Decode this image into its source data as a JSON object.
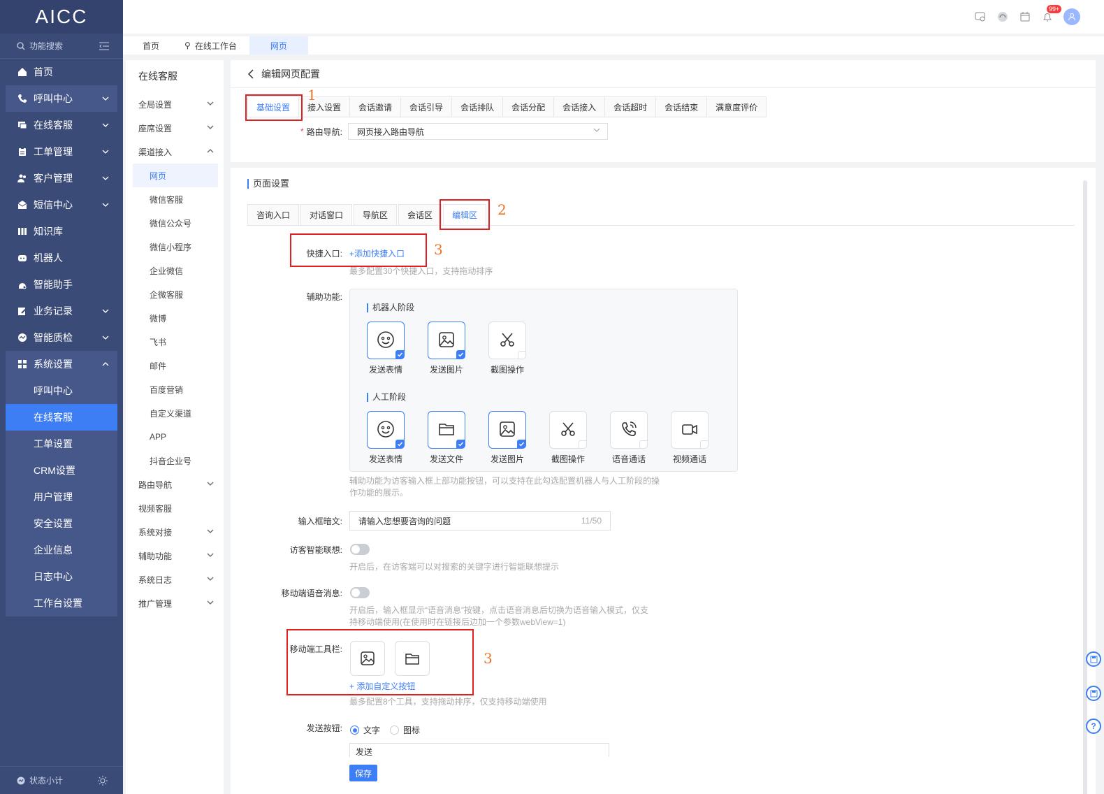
{
  "app": {
    "logo": "AICC",
    "search_label": "功能搜索",
    "footer_label": "状态小计"
  },
  "sidebar": {
    "items": [
      {
        "label": "首页",
        "icon": "home-icon",
        "arrow": ""
      },
      {
        "label": "呼叫中心",
        "icon": "phone-icon",
        "arrow": "down"
      },
      {
        "label": "在线客服",
        "icon": "chat-icon",
        "arrow": "down"
      },
      {
        "label": "工单管理",
        "icon": "clipboard-icon",
        "arrow": "down"
      },
      {
        "label": "客户管理",
        "icon": "users-icon",
        "arrow": "down"
      },
      {
        "label": "短信中心",
        "icon": "mail-icon",
        "arrow": "down"
      },
      {
        "label": "知识库",
        "icon": "book-icon",
        "arrow": ""
      },
      {
        "label": "机器人",
        "icon": "robot-icon",
        "arrow": ""
      },
      {
        "label": "智能助手",
        "icon": "assistant-icon",
        "arrow": ""
      },
      {
        "label": "业务记录",
        "icon": "edit-icon",
        "arrow": "down"
      },
      {
        "label": "智能质检",
        "icon": "quality-icon",
        "arrow": "down"
      },
      {
        "label": "系统设置",
        "icon": "grid-icon",
        "arrow": "up"
      }
    ],
    "sub_items": [
      "呼叫中心",
      "在线客服",
      "工单设置",
      "CRM设置",
      "用户管理",
      "安全设置",
      "企业信息",
      "日志中心",
      "工作台设置"
    ]
  },
  "page_tabs": [
    "首页",
    "在线工作台",
    "网页"
  ],
  "subnav": {
    "title": "在线客服",
    "items": [
      {
        "label": "全局设置",
        "arrow": "down"
      },
      {
        "label": "座席设置",
        "arrow": "down"
      },
      {
        "label": "渠道接入",
        "arrow": "up"
      }
    ],
    "children": [
      "网页",
      "微信客服",
      "微信公众号",
      "微信小程序",
      "企业微信",
      "企微客服",
      "微博",
      "飞书",
      "邮件",
      "百度营销",
      "自定义渠道",
      "APP",
      "抖音企业号"
    ],
    "items2": [
      {
        "label": "路由导航",
        "arrow": "down"
      },
      {
        "label": "视频客服",
        "arrow": ""
      },
      {
        "label": "系统对接",
        "arrow": "down"
      },
      {
        "label": "辅助功能",
        "arrow": "down"
      },
      {
        "label": "系统日志",
        "arrow": "down"
      },
      {
        "label": "推广管理",
        "arrow": "down"
      }
    ]
  },
  "main": {
    "header": "编辑网页配置",
    "func_tabs": [
      "基础设置",
      "接入设置",
      "会话邀请",
      "会话引导",
      "会话排队",
      "会话分配",
      "会话接入",
      "会话超时",
      "会话结束",
      "满意度评价"
    ],
    "route_label": "路由导航:",
    "route_value": "网页接入路由导航",
    "section_title": "页面设置",
    "inner_tabs": [
      "咨询入口",
      "对话窗口",
      "导航区",
      "会话区",
      "编辑区"
    ],
    "quick_label": "快捷入口:",
    "quick_link": "+添加快捷入口",
    "quick_hint": "最多配置30个快捷入口，支持拖动排序",
    "aux_label": "辅助功能:",
    "robot_stage": "机器人阶段",
    "robot_tools": [
      {
        "label": "发送表情",
        "icon": "emoji-icon",
        "checked": true
      },
      {
        "label": "发送图片",
        "icon": "image-icon",
        "checked": true
      },
      {
        "label": "截图操作",
        "icon": "scissors-icon",
        "checked": false
      }
    ],
    "human_stage": "人工阶段",
    "human_tools": [
      {
        "label": "发送表情",
        "icon": "emoji-icon",
        "checked": true
      },
      {
        "label": "发送文件",
        "icon": "folder-icon",
        "checked": true
      },
      {
        "label": "发送图片",
        "icon": "image-icon",
        "checked": true
      },
      {
        "label": "截图操作",
        "icon": "scissors-icon",
        "checked": false
      },
      {
        "label": "语音通话",
        "icon": "phone-call-icon",
        "checked": false
      },
      {
        "label": "视频通话",
        "icon": "video-icon",
        "checked": false
      }
    ],
    "aux_hint_1": "辅助功能为访客输入框上部功能按钮，可以支持在此勾选配置机器人与人工阶段的操",
    "aux_hint_2": "作功能的展示。",
    "input_label": "输入框暗文:",
    "input_value": "请输入您想要咨询的问题",
    "input_count": "11/50",
    "assoc_label": "访客智能联想:",
    "assoc_hint": "开启后，在访客端可以对搜索的关键字进行智能联想提示",
    "voice_label": "移动端语音消息:",
    "voice_hint_1": "开启后，输入框显示“语音消息”按键，点击语音消息后切换为语音输入模式，仅支",
    "voice_hint_2": "持移动端使用(在使用时在链接后边加一个参数webView=1)",
    "toolbar_label": "移动端工具栏:",
    "toolbar_link": "+ 添加自定义按钮",
    "toolbar_hint": "最多配置8个工具，支持拖动排序，仅支持移动端使用",
    "send_label": "发送按钮:",
    "send_opt_text": "文字",
    "send_opt_icon": "图标",
    "send_value": "发送",
    "save": "保存"
  },
  "annotations": [
    "1",
    "2",
    "3",
    "3"
  ],
  "notify_badge": "99+",
  "colors": {
    "sidebar": "#3b4b78",
    "accent": "#3d7ef5",
    "highlight": "#e02020",
    "annotation": "#e8742a"
  }
}
